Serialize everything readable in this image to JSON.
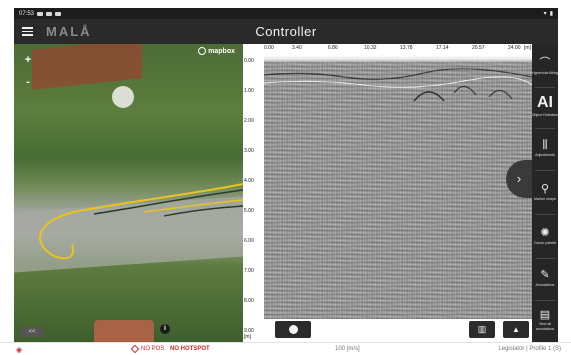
{
  "statusbar": {
    "time": "07:53",
    "icons_left": [
      "cloud-icon",
      "image-icon",
      "notification-icon"
    ],
    "icons_right": [
      "wifi-icon",
      "battery-icon"
    ]
  },
  "header": {
    "brand": "MALÅ",
    "title": "Controller"
  },
  "map": {
    "zoom_in": "+",
    "zoom_out": "-",
    "attribution": "mapbox",
    "info": "i",
    "collapse": "<<"
  },
  "radargram": {
    "distance_ticks": [
      "0.00",
      "3.40",
      "6.86",
      "10.32",
      "13.78",
      "17.14",
      "20.57",
      "24.00"
    ],
    "distance_unit": "[m]",
    "depth_ticks": [
      "0.00",
      "1.00",
      "2.00",
      "3.00",
      "4.00",
      "5.00",
      "6.00",
      "7.00",
      "8.00",
      "9.00"
    ],
    "depth_unit": "[m]"
  },
  "controls": {
    "record": "record-icon",
    "map_toggle": "map-icon",
    "up": "▲",
    "expand": "›"
  },
  "sidebar": {
    "items": [
      {
        "icon": "hyperbola-icon",
        "label": "Hyperbola fitting"
      },
      {
        "icon": "AI",
        "label": "Object Detection"
      },
      {
        "icon": "settings-sliders-icon",
        "label": "Adjustments"
      },
      {
        "icon": "marker-icon",
        "label": "Marker shape"
      },
      {
        "icon": "palette-icon",
        "label": "Colour palette"
      },
      {
        "icon": "annotation-icon",
        "label": "Annotations"
      },
      {
        "icon": "document-icon",
        "label": "View all annotations"
      }
    ]
  },
  "statusbottom": {
    "gps": "NO POS",
    "hotspot": "NO HOTSPOT",
    "speed": "100 [m/s]",
    "profile": "Legislator | Profile 1 (S)"
  },
  "colors": {
    "header": "#2a2a2a",
    "sidebar": "#262626",
    "alert": "#d12a2a",
    "track_yellow": "#e8c51c",
    "track_dark": "#2c3a2a"
  }
}
